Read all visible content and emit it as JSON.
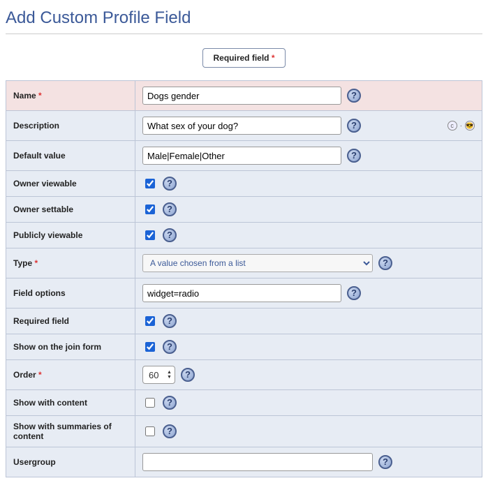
{
  "page": {
    "title": "Add Custom Profile Field"
  },
  "badge": {
    "text": "Required field",
    "glyph": "*"
  },
  "help_glyph": "?",
  "fields": {
    "name": {
      "label": "Name",
      "required": "*",
      "value": "Dogs gender"
    },
    "description": {
      "label": "Description",
      "value": "What sex of your dog?"
    },
    "default_value": {
      "label": "Default value",
      "value": "Male|Female|Other"
    },
    "owner_viewable": {
      "label": "Owner viewable",
      "checked": true
    },
    "owner_settable": {
      "label": "Owner settable",
      "checked": true
    },
    "publicly_viewable": {
      "label": "Publicly viewable",
      "checked": true
    },
    "type": {
      "label": "Type",
      "required": "*",
      "selected": "A value chosen from a list"
    },
    "field_options": {
      "label": "Field options",
      "value": "widget=radio"
    },
    "required": {
      "label": "Required field",
      "checked": true
    },
    "show_join": {
      "label": "Show on the join form",
      "checked": true
    },
    "order": {
      "label": "Order",
      "required": "*",
      "value": "60"
    },
    "show_content": {
      "label": "Show with content",
      "checked": false
    },
    "show_summaries": {
      "label": "Show with summaries of content",
      "checked": false
    },
    "usergroup": {
      "label": "Usergroup",
      "value": ""
    }
  },
  "side": {
    "a": "c",
    "dot": "·",
    "b": "😎"
  }
}
